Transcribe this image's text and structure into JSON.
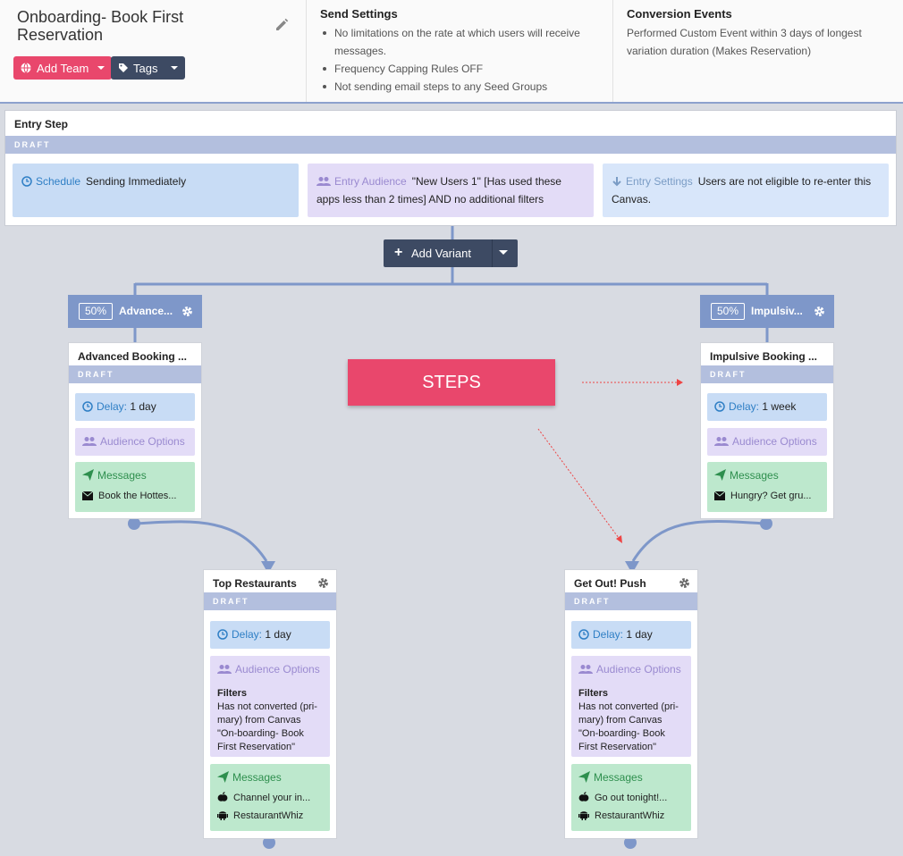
{
  "header": {
    "canvas_name": "Onboarding- Book First Reservation",
    "add_team_label": "Add Team",
    "tags_label": "Tags",
    "send_settings": {
      "title": "Send Settings",
      "items": [
        "No limitations on the rate at which users will receive messages.",
        "Frequency Capping Rules OFF",
        "Not sending email steps to any Seed Groups"
      ]
    },
    "conversion_events": {
      "title": "Conversion Events",
      "text": "Performed Custom Event within 3 days of longest variation duration (Makes Reservation)"
    }
  },
  "entry_step": {
    "title": "Entry Step",
    "status": "DRAFT",
    "schedule_label": "Schedule",
    "schedule_value": "Sending Immediately",
    "audience_label": "Entry Audience",
    "audience_value": "\"New Users 1\" [Has used these apps less than 2 times] AND no additional filters",
    "settings_label": "Entry Settings",
    "settings_value": "Users are not eligible to re-enter this Canvas."
  },
  "add_variant_label": "Add Variant",
  "variants": [
    {
      "percent": "50%",
      "name": "Advance...",
      "step": {
        "title": "Advanced Booking ...",
        "status": "DRAFT",
        "delay_label": "Delay:",
        "delay_value": "1 day",
        "audience_label": "Audience Options",
        "messages_label": "Messages",
        "message": "Book the Hottes..."
      }
    },
    {
      "percent": "50%",
      "name": "Impulsiv...",
      "step": {
        "title": "Impulsive Booking ...",
        "status": "DRAFT",
        "delay_label": "Delay:",
        "delay_value": "1 week",
        "audience_label": "Audience Options",
        "messages_label": "Messages",
        "message": "Hungry? Get gru..."
      }
    }
  ],
  "steps_banner": "STEPS",
  "followups": [
    {
      "title": "Top Restaurants",
      "status": "DRAFT",
      "delay_label": "Delay:",
      "delay_value": "1 day",
      "audience_label": "Audience Options",
      "filters_title": "Filters",
      "filters_text": "Has not converted (pri-mary) from Canvas \"On-boarding- Book First Reservation\"",
      "messages_label": "Messages",
      "ios_message": "Channel your in...",
      "android_message": "RestaurantWhiz"
    },
    {
      "title": "Get Out! Push",
      "status": "DRAFT",
      "delay_label": "Delay:",
      "delay_value": "1 day",
      "audience_label": "Audience Options",
      "filters_title": "Filters",
      "filters_text": "Has not converted (pri-mary) from Canvas \"On-boarding- Book First Reservation\"",
      "messages_label": "Messages",
      "ios_message": "Go out tonight!...",
      "android_message": "RestaurantWhiz"
    }
  ],
  "colors": {
    "accent_pink": "#e9476c",
    "navy": "#3d4a63",
    "connector": "#7e97c9"
  }
}
